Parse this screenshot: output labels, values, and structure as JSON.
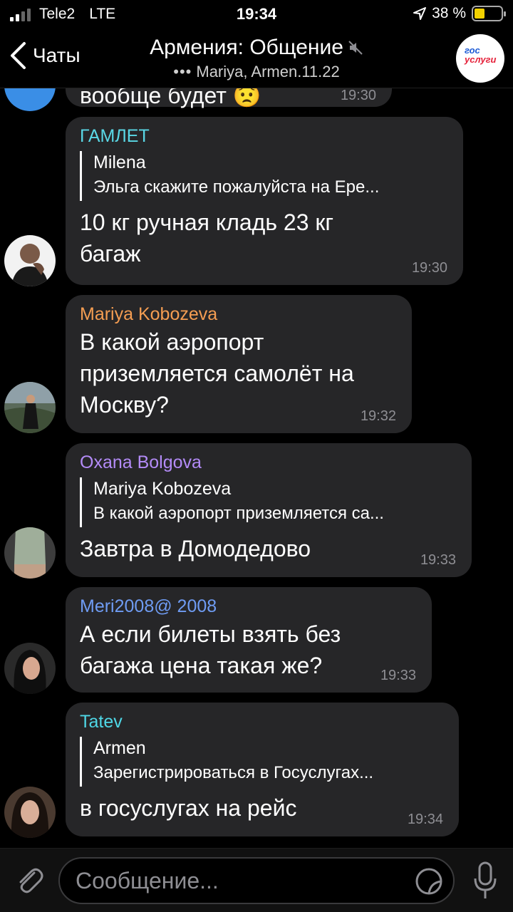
{
  "status_bar": {
    "carrier": "Tele2",
    "network": "LTE",
    "time": "19:34",
    "battery": "38 %",
    "battery_level": 0.38
  },
  "header": {
    "back_label": "Чаты",
    "title": "Армения: Общение",
    "typing_dots": "•••",
    "subtitle": "Mariya, Armen.11.22",
    "logo_line1": "гос",
    "logo_line2": "услуги"
  },
  "partial_message": {
    "text": "вообще будет 😟",
    "time": "19:30"
  },
  "messages": [
    {
      "sender": "ГАМЛЕТ",
      "sender_color": "#5ad8e6",
      "reply_name": "Milena",
      "reply_text": "Эльга скажите пожалуйста на Ере...",
      "text": "10 кг ручная кладь 23 кг багаж",
      "time": "19:30"
    },
    {
      "sender": "Mariya Kobozeva",
      "sender_color": "#f49d52",
      "text": "В какой аэропорт приземляется самолёт на Москву?",
      "time": "19:32"
    },
    {
      "sender": "Oxana Bolgova",
      "sender_color": "#b38bf7",
      "reply_name": "Mariya Kobozeva",
      "reply_text": "В какой аэропорт приземляется са...",
      "text": "Завтра в Домодедово",
      "time": "19:33"
    },
    {
      "sender": "Meri2008@ 2008",
      "sender_color": "#6f9cf3",
      "text": "А если билеты взять  без багажа цена такая же?",
      "time": "19:33"
    },
    {
      "sender": "Tatev",
      "sender_color": "#4fd7e6",
      "reply_name": "Armen",
      "reply_text": "Зарегистрироваться в Госуслугах...",
      "text": "в госуслугах на рейс",
      "time": "19:34"
    }
  ],
  "composer": {
    "placeholder": "Сообщение..."
  }
}
